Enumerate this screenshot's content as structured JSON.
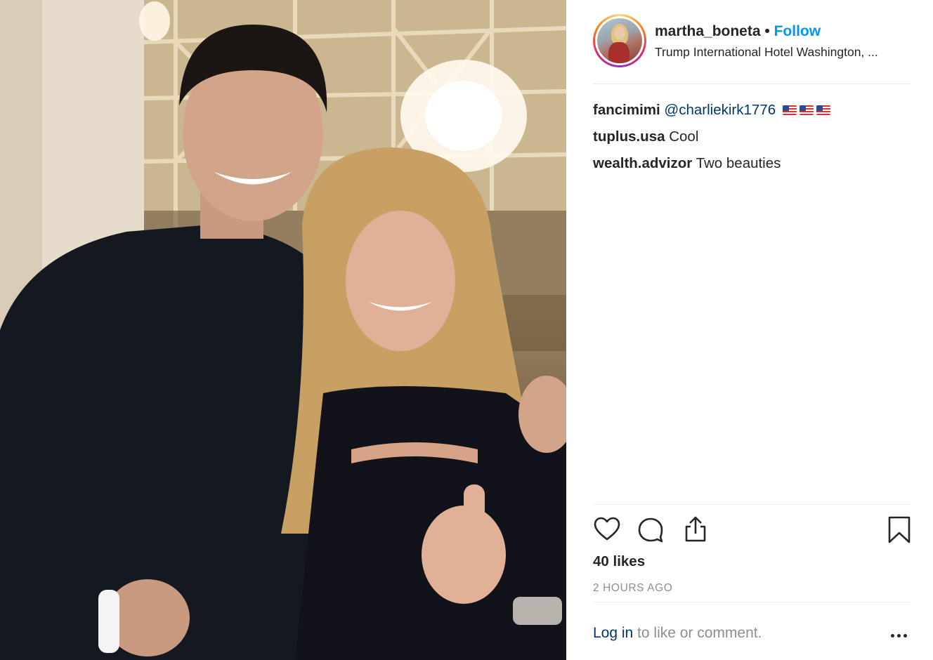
{
  "post": {
    "username": "martha_boneta",
    "dot": "•",
    "follow_label": "Follow",
    "location": "Trump International Hotel Washington, ...",
    "likes": "40 likes",
    "time": "2 HOURS AGO"
  },
  "comments": [
    {
      "user": "fancimimi",
      "text": "",
      "mention": "@charliekirk1776",
      "flags": 3
    },
    {
      "user": "tuplus.usa",
      "text": "Cool",
      "mention": ""
    },
    {
      "user": "wealth.advizor",
      "text": "Two beauties",
      "mention": ""
    }
  ],
  "footer": {
    "login_label": "Log in",
    "login_suffix": " to like or comment."
  },
  "icons": {
    "like": "heart-icon",
    "comment": "comment-bubble-icon",
    "share": "share-icon",
    "save": "bookmark-icon",
    "more": "more-options-icon"
  },
  "colors": {
    "follow": "#0095f6",
    "mention": "#00376b",
    "muted": "#8e8e8e"
  }
}
